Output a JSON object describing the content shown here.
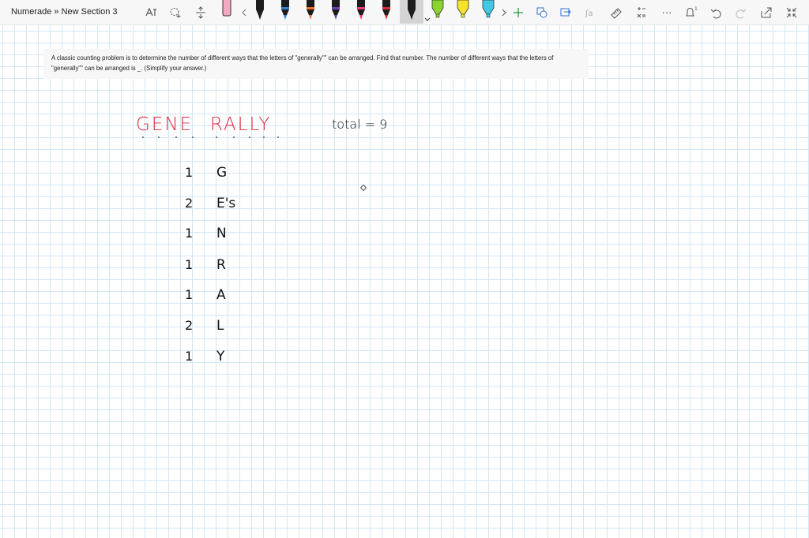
{
  "toolbar": {
    "breadcrumb": "Numerade » New Section 3",
    "pens": [
      {
        "icon": "pen-icon",
        "color": "#f2a9c4"
      },
      {
        "icon": "pen-icon",
        "color": "#1c1c1c"
      },
      {
        "icon": "pen-icon",
        "color": "#2f7fd6"
      },
      {
        "icon": "pen-icon",
        "color": "#e86b27"
      },
      {
        "icon": "pen-icon",
        "color": "#6d3fb4"
      },
      {
        "icon": "pen-icon",
        "color": "#e83a7c"
      },
      {
        "icon": "pen-icon",
        "color": "#d9293a"
      },
      {
        "icon": "pen-icon",
        "color": "#1c1c1c"
      },
      {
        "icon": "highlighter-icon",
        "color": "#8bd42f"
      },
      {
        "icon": "highlighter-icon",
        "color": "#f5e22a"
      },
      {
        "icon": "highlighter-icon",
        "color": "#3fc9e6"
      }
    ]
  },
  "problem": {
    "text": "A classic counting problem is to determine the number of different ways that the letters of \"generally\"\" can be arranged. Find that number. The number of different ways that the letters of \"generally\"\" can be arranged is _. (Simplify your answer.)"
  },
  "handwriting": {
    "word_left": "GENE",
    "word_right": "RALLY",
    "total": "total = 9",
    "rows": [
      {
        "count": "1",
        "letter": "G"
      },
      {
        "count": "2",
        "letter": "E's"
      },
      {
        "count": "1",
        "letter": "N"
      },
      {
        "count": "1",
        "letter": "R"
      },
      {
        "count": "1",
        "letter": "A"
      },
      {
        "count": "2",
        "letter": "L"
      },
      {
        "count": "1",
        "letter": "Y"
      }
    ]
  },
  "colors": {
    "ink_red": "#e0283c",
    "ink_black": "#111111",
    "grid": "#d3e6f3"
  }
}
